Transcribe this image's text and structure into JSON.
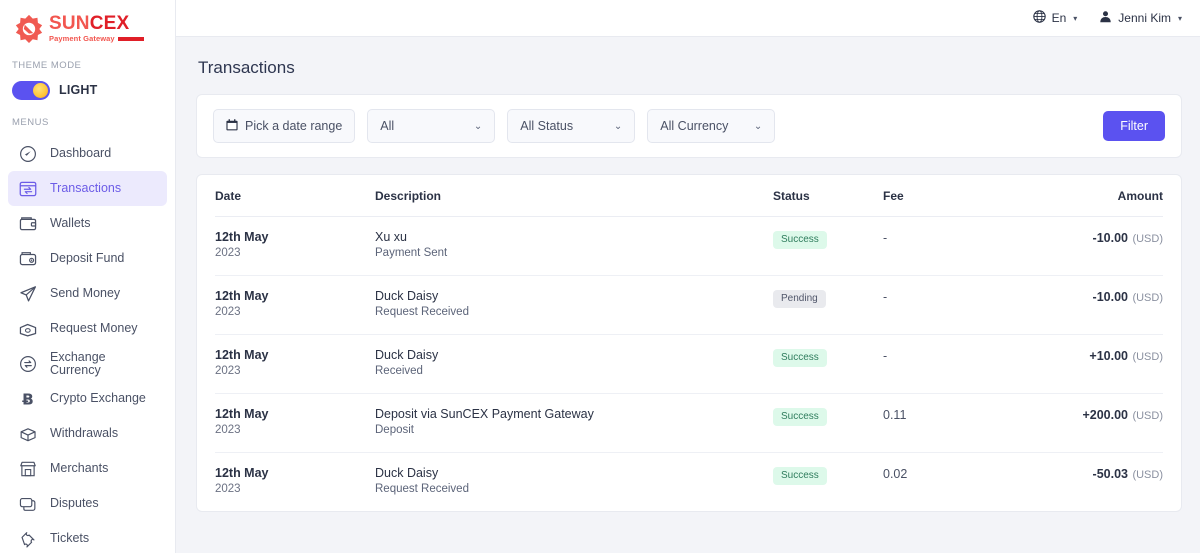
{
  "brand": {
    "name_part1": "SUN",
    "name_part2": "CEX",
    "tagline": "Payment Gateway",
    "logo_color_light": "#f2564f",
    "logo_color_dark": "#e01f28"
  },
  "sidebar": {
    "theme_section_label": "THEME MODE",
    "theme_mode_value": "LIGHT",
    "menus_section_label": "MENUS",
    "accent_color": "#6c5ce7",
    "items": [
      {
        "label": "Dashboard",
        "icon": "speedometer-icon",
        "active": false
      },
      {
        "label": "Transactions",
        "icon": "transactions-icon",
        "active": true
      },
      {
        "label": "Wallets",
        "icon": "wallet-icon",
        "active": false
      },
      {
        "label": "Deposit Fund",
        "icon": "deposit-fund-icon",
        "active": false
      },
      {
        "label": "Send Money",
        "icon": "send-money-icon",
        "active": false
      },
      {
        "label": "Request Money",
        "icon": "request-money-icon",
        "active": false
      },
      {
        "label": "Exchange Currency",
        "icon": "exchange-currency-icon",
        "active": false
      },
      {
        "label": "Crypto Exchange",
        "icon": "bitcoin-icon",
        "active": false
      },
      {
        "label": "Withdrawals",
        "icon": "withdrawals-icon",
        "active": false
      },
      {
        "label": "Merchants",
        "icon": "merchants-icon",
        "active": false
      },
      {
        "label": "Disputes",
        "icon": "disputes-icon",
        "active": false
      },
      {
        "label": "Tickets",
        "icon": "tickets-icon",
        "active": false
      }
    ]
  },
  "topbar": {
    "language": "En",
    "language_icon": "globe-icon",
    "user_name": "Jenni Kim",
    "user_icon": "user-avatar-icon",
    "caret": "▾"
  },
  "page": {
    "title": "Transactions"
  },
  "filters": {
    "date_range_label": "Pick a date range",
    "date_icon": "calendar-icon",
    "type_select_value": "All",
    "status_select_value": "All Status",
    "currency_select_value": "All Currency",
    "caret": "⌄",
    "filter_button_label": "Filter",
    "filter_button_color": "#5b52f0"
  },
  "table": {
    "columns": [
      "Date",
      "Description",
      "Status",
      "Fee",
      "Amount"
    ],
    "rows": [
      {
        "date_day": "12th May",
        "date_year": "2023",
        "desc_main": "Xu xu",
        "desc_sub": "Payment Sent",
        "status": "Success",
        "status_kind": "success",
        "fee": "-",
        "amount": "-10.00",
        "currency": "(USD)"
      },
      {
        "date_day": "12th May",
        "date_year": "2023",
        "desc_main": "Duck Daisy",
        "desc_sub": "Request Received",
        "status": "Pending",
        "status_kind": "pending",
        "fee": "-",
        "amount": "-10.00",
        "currency": "(USD)"
      },
      {
        "date_day": "12th May",
        "date_year": "2023",
        "desc_main": "Duck Daisy",
        "desc_sub": "Received",
        "status": "Success",
        "status_kind": "success",
        "fee": "-",
        "amount": "+10.00",
        "currency": "(USD)"
      },
      {
        "date_day": "12th May",
        "date_year": "2023",
        "desc_main": "Deposit via SunCEX Payment Gateway",
        "desc_sub": "Deposit",
        "status": "Success",
        "status_kind": "success",
        "fee": "0.11",
        "amount": "+200.00",
        "currency": "(USD)"
      },
      {
        "date_day": "12th May",
        "date_year": "2023",
        "desc_main": "Duck Daisy",
        "desc_sub": "Request Received",
        "status": "Success",
        "status_kind": "success",
        "fee": "0.02",
        "amount": "-50.03",
        "currency": "(USD)"
      }
    ]
  }
}
